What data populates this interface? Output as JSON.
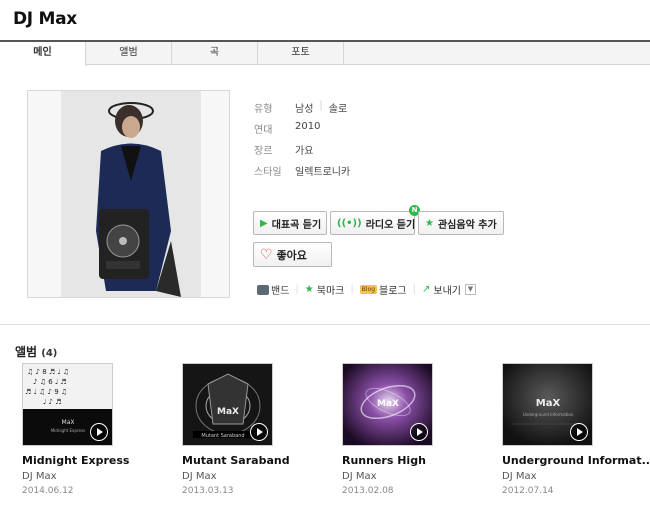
{
  "artist_title": "DJ Max",
  "tabs": [
    "메인",
    "앨범",
    "곡",
    "포토"
  ],
  "info": {
    "type_label": "유형",
    "gender": "남성",
    "solo": "솔로",
    "era_label": "연대",
    "era": "2010",
    "genre_label": "장르",
    "genre": "가요",
    "style_label": "스타일",
    "style": "일렉트로니카"
  },
  "buttons": {
    "play_rep": "대표곡 듣기",
    "radio": "라디오 듣기",
    "fav": "관심음악 추가",
    "like": "좋아요",
    "new_badge": "N"
  },
  "share": {
    "band": "밴드",
    "bookmark": "북마크",
    "blog": "블로그",
    "send": "보내기",
    "blog_badge": "Blog"
  },
  "albums_section": {
    "title": "앨범",
    "count": "(4)"
  },
  "albums": [
    {
      "name": "Midnight Express",
      "artist": "DJ Max",
      "date": "2014.06.12",
      "cover_text": "MaX",
      "cover_sub": "Midnight Express"
    },
    {
      "name": "Mutant Saraband",
      "artist": "DJ Max",
      "date": "2013.03.13",
      "cover_text": "MaX",
      "cover_sub": "Mutant Saraband"
    },
    {
      "name": "Runners High",
      "artist": "DJ Max",
      "date": "2013.02.08",
      "cover_text": "MaX",
      "cover_sub": ""
    },
    {
      "name": "Underground Informat..",
      "artist": "DJ Max",
      "date": "2012.07.14",
      "cover_text": "MaX",
      "cover_sub": "Underground Information"
    }
  ],
  "colors": {
    "accent_green": "#31b84a",
    "heart_red": "#d9313c",
    "tab_border": "#555555"
  }
}
